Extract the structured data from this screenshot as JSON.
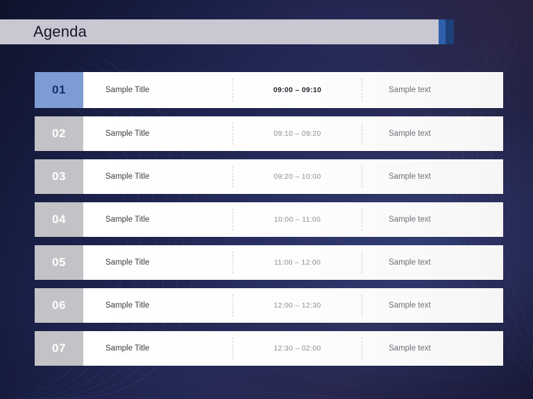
{
  "slide": {
    "title": "Agenda",
    "colors": {
      "title_plate": "#c8c7d2",
      "accent_blue": "#2f5fa8",
      "accent_dark_blue": "#1d3f7a",
      "row_number_active": "#7e9cd4",
      "row_number_inactive": "#c3c3c7",
      "background_deep": "#1b2145"
    }
  },
  "rows": [
    {
      "number": "01",
      "title": "Sample Title",
      "time": "09:00 – 09:10",
      "text": "Sample text",
      "active": true
    },
    {
      "number": "02",
      "title": "Sample Title",
      "time": "09:10 – 09:20",
      "text": "Sample text",
      "active": false
    },
    {
      "number": "03",
      "title": "Sample Title",
      "time": "09:20 – 10:00",
      "text": "Sample text",
      "active": false
    },
    {
      "number": "04",
      "title": "Sample Title",
      "time": "10:00 – 11:00",
      "text": "Sample text",
      "active": false
    },
    {
      "number": "05",
      "title": "Sample Title",
      "time": "11:00 – 12:00",
      "text": "Sample text",
      "active": false
    },
    {
      "number": "06",
      "title": "Sample Title",
      "time": "12:00 – 12:30",
      "text": "Sample text",
      "active": false
    },
    {
      "number": "07",
      "title": "Sample Title",
      "time": "12:30 – 02:00",
      "text": "Sample text",
      "active": false
    }
  ]
}
